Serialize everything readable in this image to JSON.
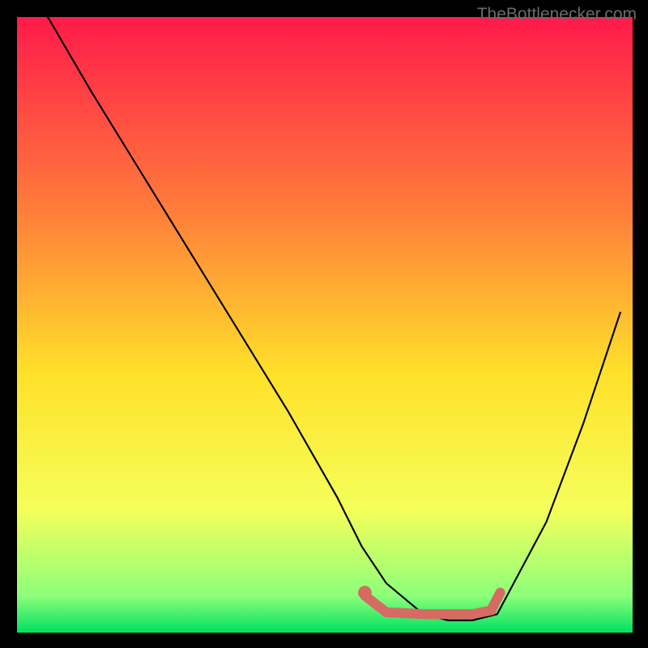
{
  "watermark": "TheBottlenecker.com",
  "chart_data": {
    "type": "line",
    "title": "",
    "xlabel": "",
    "ylabel": "",
    "xlim": [
      0,
      100
    ],
    "ylim": [
      0,
      100
    ],
    "legend": false,
    "grid": false,
    "gradient": {
      "top": "#ff1a4a",
      "mid_upper": "#ff7f3a",
      "mid": "#ffe12a",
      "mid_lower": "#f5ff5a",
      "low": "#8dff7a",
      "bottom": "#00e060"
    },
    "series": [
      {
        "name": "curve",
        "color": "#000000",
        "x": [
          5,
          12,
          20,
          28,
          36,
          44,
          52,
          56,
          60,
          66,
          70,
          74,
          78,
          86,
          92,
          98
        ],
        "y": [
          100,
          88,
          75,
          62,
          49,
          36,
          22,
          14,
          8,
          3,
          2,
          2,
          3,
          18,
          34,
          52
        ]
      },
      {
        "name": "highlight",
        "color": "#d66b63",
        "x": [
          56.5,
          60,
          66,
          70,
          74,
          77,
          78.5
        ],
        "y": [
          6.0,
          3.3,
          3.0,
          3.0,
          3.0,
          3.6,
          6.5
        ]
      }
    ],
    "highlight_dot": {
      "x": 56.5,
      "y": 6.5,
      "color": "#d66b63",
      "r": 1.1
    }
  }
}
